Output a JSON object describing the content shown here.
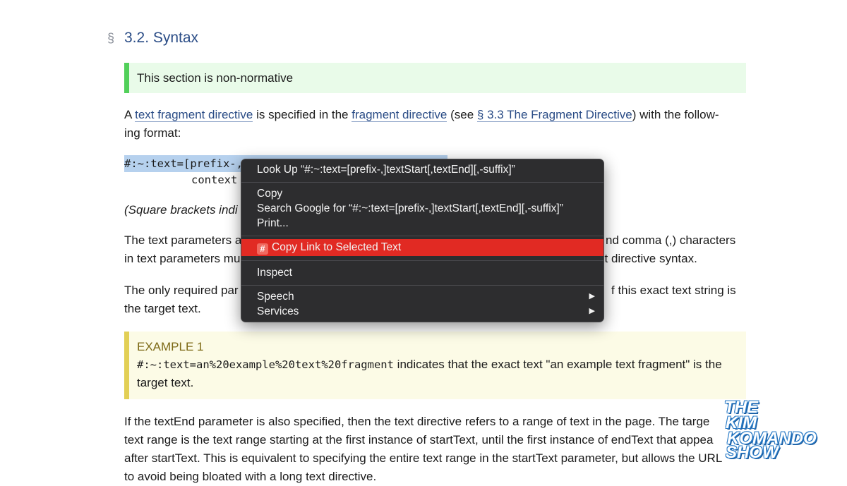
{
  "section": {
    "mark": "§",
    "title": "3.2. Syntax"
  },
  "note": "This section is non-normative",
  "para1": {
    "pre": "A ",
    "link1": "text fragment directive",
    "mid1": " is specified in the ",
    "link2": "fragment directive",
    "mid2": " (see ",
    "link3": "§ 3.3 The Fragment Directive",
    "post": ") with the follow-",
    "line2": "ing format:"
  },
  "code": {
    "line1": "#:~:text=[prefix-,]textStart[,textEnd][,-suffix]",
    "line2": "context"
  },
  "para2_visible": "(Square brackets indi",
  "para3": {
    "line1_left": "The text parameters a",
    "line1_right": "nd comma (,) characters",
    "line2_left": "in text parameters mu",
    "line2_right": "xt directive syntax."
  },
  "para4": {
    "line1_left": "The only required par",
    "line1_right": "f this exact text string is",
    "line2": "the target text."
  },
  "example": {
    "label": "EXAMPLE 1",
    "code": "#:~:text=an%20example%20text%20fragment",
    "text": " indicates that the exact text \"an example text fragment\" is the",
    "line2": "target text."
  },
  "para5": {
    "line1": "If the textEnd parameter is also specified, then the text directive refers to a range of text in the page. The targe",
    "line2": "text range is the text range starting at the first instance of startText, until the first instance of endText that appea",
    "line3": "after startText. This is equivalent to specifying the entire text range in the startText parameter, but allows the URL",
    "line4": "to avoid being bloated with a long text directive."
  },
  "context_menu": {
    "look_up": "Look Up “#:~:text=[prefix-,]textStart[,textEnd][,-suffix]”",
    "copy": "Copy",
    "search_google": "Search Google for “#:~:text=[prefix-,]textStart[,textEnd][,-suffix]”",
    "print": "Print...",
    "copy_link": "Copy Link to Selected Text",
    "copy_link_icon_glyph": "#",
    "inspect": "Inspect",
    "speech": "Speech",
    "services": "Services",
    "submenu_arrow": "▶",
    "highlight_color": "#e12a23"
  },
  "watermark": {
    "line1": "THE",
    "line2": "KIM",
    "line3": "KOMANDO",
    "line4": "SHOW"
  },
  "colors": {
    "link": "#2a4c86",
    "note_bar": "#52d05a",
    "example_bar": "#e2cf55",
    "selection": "#b6d1ee"
  }
}
